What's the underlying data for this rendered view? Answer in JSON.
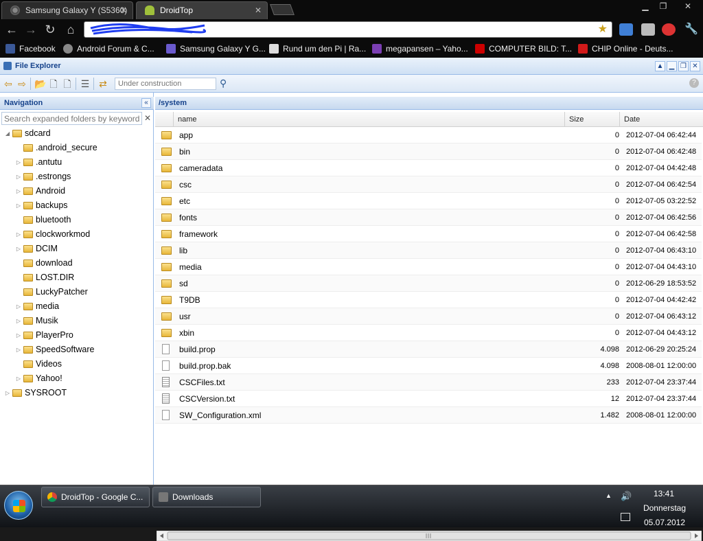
{
  "browser": {
    "tabs": [
      {
        "title": "Samsung Galaxy Y (S5360)"
      },
      {
        "title": "DroidTop"
      }
    ],
    "address_value": "",
    "bookmarks": [
      {
        "label": "Facebook",
        "color": "#3b5998"
      },
      {
        "label": "Android Forum & C...",
        "color": "#888888"
      },
      {
        "label": "Samsung Galaxy Y G...",
        "color": "#6a5acd"
      },
      {
        "label": "Rund um den Pi | Ra...",
        "color": "#dddddd"
      },
      {
        "label": "megapansen – Yaho...",
        "color": "#7b3fb3"
      },
      {
        "label": "COMPUTER BILD: T...",
        "color": "#cc0000"
      },
      {
        "label": "CHIP Online - Deuts...",
        "color": "#d11a1a"
      }
    ]
  },
  "app": {
    "title": "File Explorer",
    "toolbar_placeholder": "Under construction",
    "navigation": {
      "title": "Navigation",
      "search_placeholder": "Search expanded folders by keyword",
      "tree": [
        {
          "label": "sdcard",
          "level": 0,
          "expandable": true,
          "expanded": true
        },
        {
          "label": ".android_secure",
          "level": 1,
          "expandable": false
        },
        {
          "label": ".antutu",
          "level": 1,
          "expandable": true
        },
        {
          "label": ".estrongs",
          "level": 1,
          "expandable": true
        },
        {
          "label": "Android",
          "level": 1,
          "expandable": true
        },
        {
          "label": "backups",
          "level": 1,
          "expandable": true
        },
        {
          "label": "bluetooth",
          "level": 1,
          "expandable": false
        },
        {
          "label": "clockworkmod",
          "level": 1,
          "expandable": true
        },
        {
          "label": "DCIM",
          "level": 1,
          "expandable": true
        },
        {
          "label": "download",
          "level": 1,
          "expandable": false
        },
        {
          "label": "LOST.DIR",
          "level": 1,
          "expandable": false
        },
        {
          "label": "LuckyPatcher",
          "level": 1,
          "expandable": false
        },
        {
          "label": "media",
          "level": 1,
          "expandable": true
        },
        {
          "label": "Musik",
          "level": 1,
          "expandable": true
        },
        {
          "label": "PlayerPro",
          "level": 1,
          "expandable": true
        },
        {
          "label": "SpeedSoftware",
          "level": 1,
          "expandable": true
        },
        {
          "label": "Videos",
          "level": 1,
          "expandable": false
        },
        {
          "label": "Yahoo!",
          "level": 1,
          "expandable": true
        },
        {
          "label": "SYSROOT",
          "level": 0,
          "expandable": true,
          "expanded": false
        }
      ]
    },
    "current_path": "/system",
    "columns": {
      "name": "name",
      "size": "Size",
      "date": "Date"
    },
    "files": [
      {
        "name": "app",
        "type": "folder",
        "size": "0",
        "date": "2012-07-04 06:42:44"
      },
      {
        "name": "bin",
        "type": "folder",
        "size": "0",
        "date": "2012-07-04 06:42:48"
      },
      {
        "name": "cameradata",
        "type": "folder",
        "size": "0",
        "date": "2012-07-04 04:42:48"
      },
      {
        "name": "csc",
        "type": "folder",
        "size": "0",
        "date": "2012-07-04 06:42:54"
      },
      {
        "name": "etc",
        "type": "folder",
        "size": "0",
        "date": "2012-07-05 03:22:52"
      },
      {
        "name": "fonts",
        "type": "folder",
        "size": "0",
        "date": "2012-07-04 06:42:56"
      },
      {
        "name": "framework",
        "type": "folder",
        "size": "0",
        "date": "2012-07-04 06:42:58"
      },
      {
        "name": "lib",
        "type": "folder",
        "size": "0",
        "date": "2012-07-04 06:43:10"
      },
      {
        "name": "media",
        "type": "folder",
        "size": "0",
        "date": "2012-07-04 04:43:10"
      },
      {
        "name": "sd",
        "type": "folder",
        "size": "0",
        "date": "2012-06-29 18:53:52"
      },
      {
        "name": "T9DB",
        "type": "folder",
        "size": "0",
        "date": "2012-07-04 04:42:42"
      },
      {
        "name": "usr",
        "type": "folder",
        "size": "0",
        "date": "2012-07-04 06:43:12"
      },
      {
        "name": "xbin",
        "type": "folder",
        "size": "0",
        "date": "2012-07-04 04:43:12"
      },
      {
        "name": "build.prop",
        "type": "file",
        "size": "4.098",
        "date": "2012-06-29 20:25:24"
      },
      {
        "name": "build.prop.bak",
        "type": "file",
        "size": "4.098",
        "date": "2008-08-01 12:00:00"
      },
      {
        "name": "CSCFiles.txt",
        "type": "text",
        "size": "233",
        "date": "2012-07-04 23:37:44"
      },
      {
        "name": "CSCVersion.txt",
        "type": "text",
        "size": "12",
        "date": "2012-07-04 23:37:44"
      },
      {
        "name": "SW_Configuration.xml",
        "type": "file",
        "size": "1.482",
        "date": "2008-08-01 12:00:00"
      }
    ]
  },
  "taskbar": {
    "items": [
      {
        "label": "DroidTop - Google C...",
        "color": "#4aa3df"
      },
      {
        "label": "Downloads",
        "color": "#777777"
      }
    ],
    "time": "13:41",
    "day": "Donnerstag",
    "date": "05.07.2012"
  }
}
